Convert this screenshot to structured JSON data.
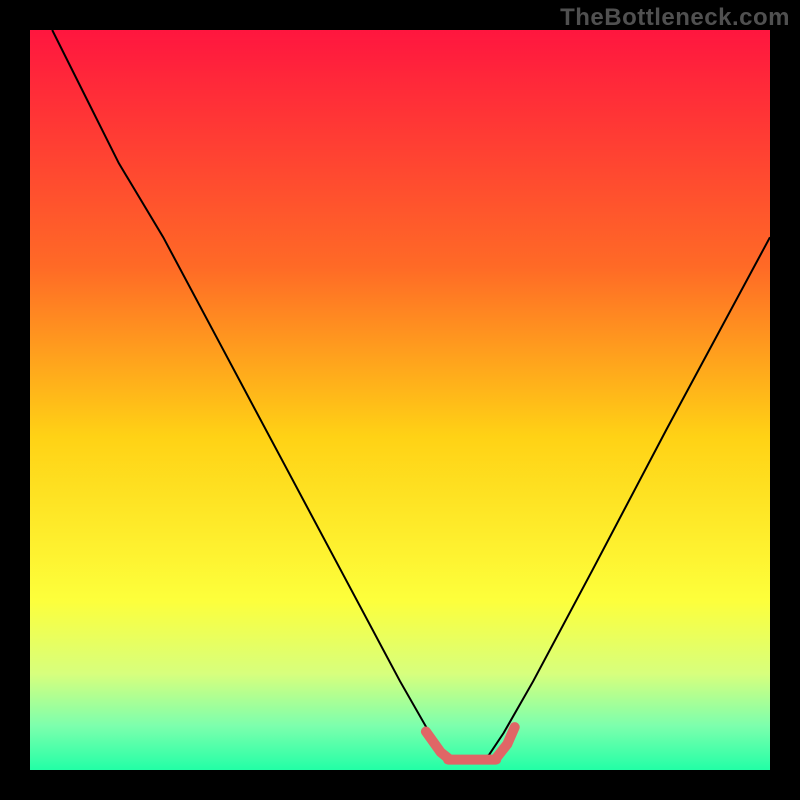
{
  "watermark": "TheBottleneck.com",
  "chart_data": {
    "type": "line",
    "title": "",
    "xlabel": "",
    "ylabel": "",
    "xlim": [
      0,
      100
    ],
    "ylim": [
      0,
      100
    ],
    "gradient_stops": [
      {
        "offset": 0,
        "color": "#ff163f"
      },
      {
        "offset": 32,
        "color": "#ff6a26"
      },
      {
        "offset": 55,
        "color": "#ffd215"
      },
      {
        "offset": 77,
        "color": "#fdff3b"
      },
      {
        "offset": 87,
        "color": "#d7ff7d"
      },
      {
        "offset": 94,
        "color": "#7dffad"
      },
      {
        "offset": 100,
        "color": "#22ffa6"
      }
    ],
    "series": [
      {
        "name": "bottleneck-curve",
        "color": "#000000",
        "width": 2,
        "x": [
          3,
          8,
          12,
          18,
          26,
          34,
          42,
          50,
          54,
          56,
          58,
          60,
          62,
          64,
          68,
          76,
          86,
          100
        ],
        "y": [
          100,
          90,
          82,
          72,
          57,
          42,
          27,
          12,
          5,
          2,
          1.2,
          1.2,
          2,
          5,
          12,
          27,
          46,
          72
        ]
      },
      {
        "name": "optimal-band-left",
        "color": "#e06666",
        "width": 10,
        "cap": "round",
        "x": [
          53.5,
          55.5,
          56.5
        ],
        "y": [
          5.2,
          2.4,
          1.6
        ]
      },
      {
        "name": "optimal-band-flat",
        "color": "#e06666",
        "width": 10,
        "cap": "round",
        "x": [
          56.5,
          63.0
        ],
        "y": [
          1.4,
          1.4
        ]
      },
      {
        "name": "optimal-band-right",
        "color": "#e06666",
        "width": 10,
        "cap": "round",
        "x": [
          63.0,
          64.5,
          65.5
        ],
        "y": [
          1.6,
          3.5,
          5.8
        ]
      }
    ]
  }
}
